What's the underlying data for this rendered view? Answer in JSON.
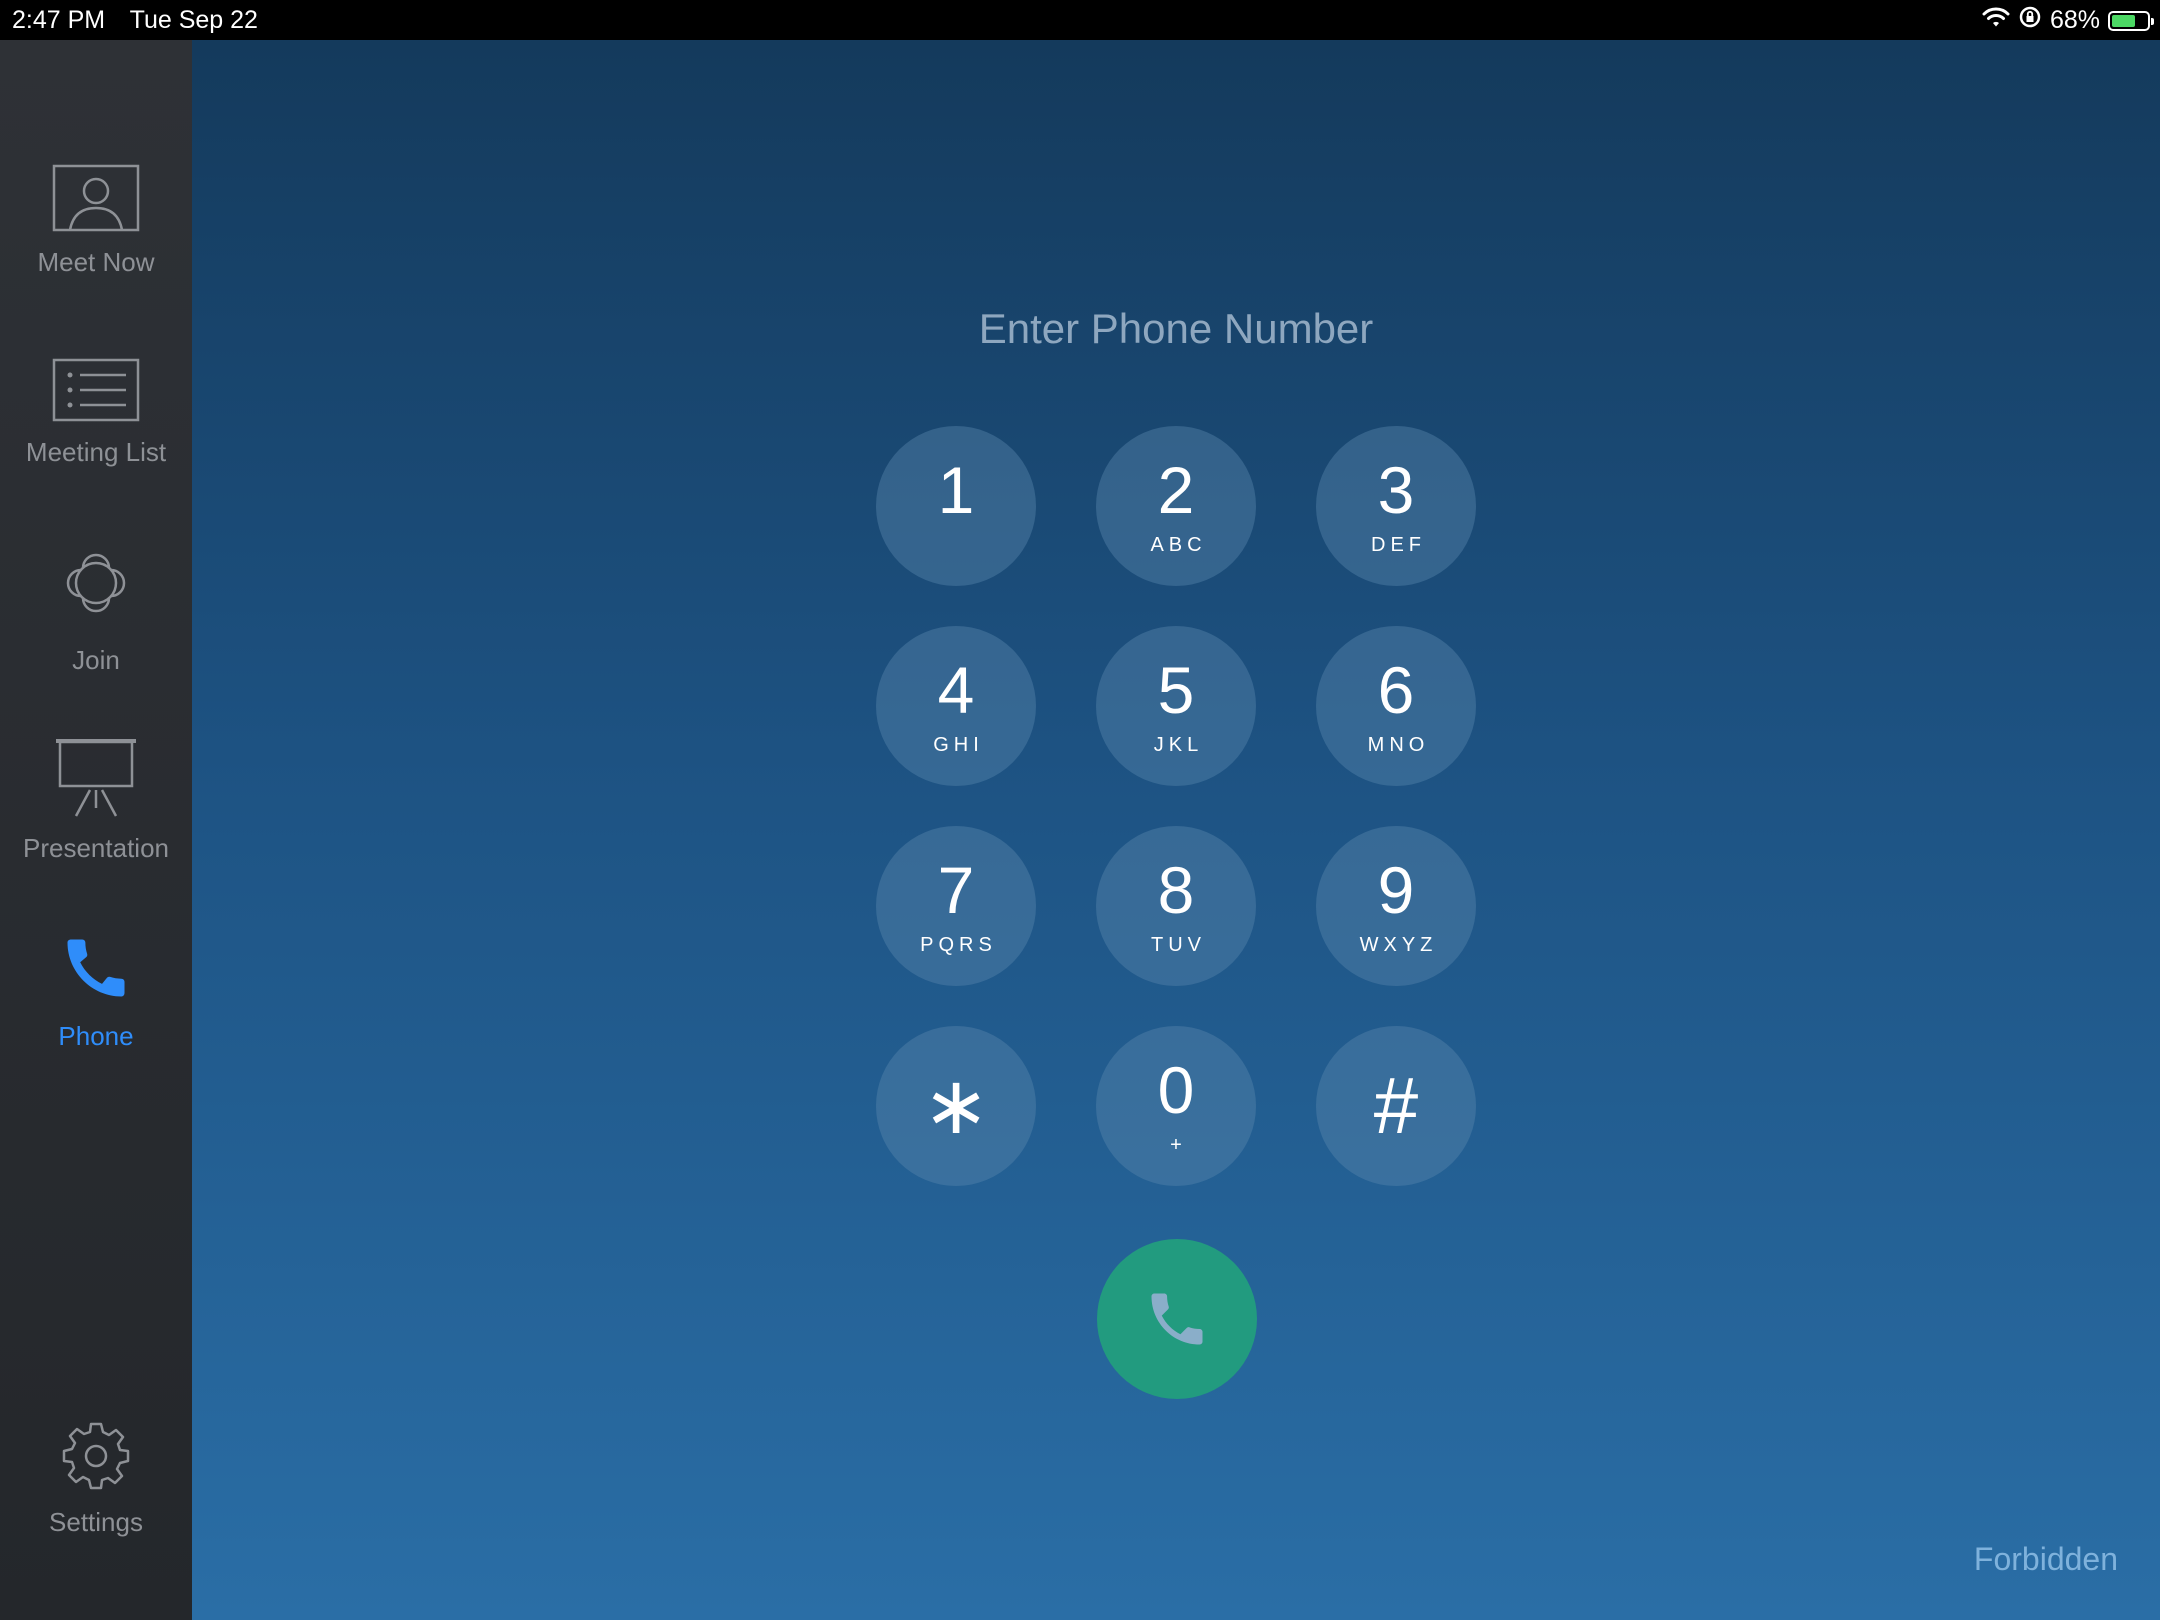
{
  "status_bar": {
    "time": "2:47 PM",
    "date": "Tue Sep 22",
    "battery_percent": "68%",
    "battery_level": 0.68,
    "icons": [
      "wifi-icon",
      "orientation-lock-icon",
      "battery-icon"
    ]
  },
  "sidebar": {
    "items": [
      {
        "label": "Meet Now",
        "icon": "person-icon"
      },
      {
        "label": "Meeting List",
        "icon": "list-icon"
      },
      {
        "label": "Join",
        "icon": "join-icon"
      },
      {
        "label": "Presentation",
        "icon": "presentation-icon"
      },
      {
        "label": "Phone",
        "icon": "phone-icon",
        "active": true
      }
    ],
    "settings": {
      "label": "Settings",
      "icon": "gear-icon"
    }
  },
  "dialer": {
    "placeholder": "Enter Phone Number",
    "keys": [
      {
        "digit": "1",
        "letters": ""
      },
      {
        "digit": "2",
        "letters": "ABC"
      },
      {
        "digit": "3",
        "letters": "DEF"
      },
      {
        "digit": "4",
        "letters": "GHI"
      },
      {
        "digit": "5",
        "letters": "JKL"
      },
      {
        "digit": "6",
        "letters": "MNO"
      },
      {
        "digit": "7",
        "letters": "PQRS"
      },
      {
        "digit": "8",
        "letters": "TUV"
      },
      {
        "digit": "9",
        "letters": "WXYZ"
      },
      {
        "digit": "∗",
        "letters": ""
      },
      {
        "digit": "0",
        "letters": "+"
      },
      {
        "digit": "#",
        "letters": ""
      }
    ],
    "call_icon": "phone-icon"
  },
  "status_message": "Forbidden",
  "colors": {
    "accent": "#2f8dfa",
    "call": "#229b7f",
    "sidebar": "#2a2d31",
    "background_top": "#143a5c",
    "background_bottom": "#2a6ea6"
  }
}
